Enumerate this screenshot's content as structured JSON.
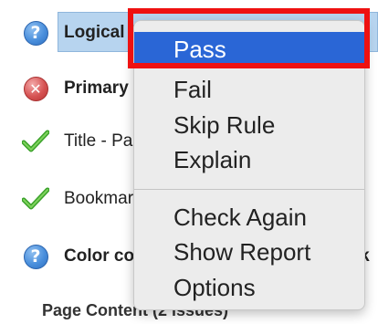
{
  "rows": [
    {
      "label": "Logical Reading Order Header",
      "icon": "question-icon"
    },
    {
      "label": "Primary language",
      "icon": "fail-icon"
    },
    {
      "label": "Title - Passed",
      "icon": "check-icon"
    },
    {
      "label": "Bookmarks - Passed",
      "icon": "check-icon"
    },
    {
      "label": "Color contrast - Needs manual check",
      "icon": "question-icon"
    }
  ],
  "section_heading": "Page Content (2 issues)",
  "context_menu": {
    "items": [
      "Pass",
      "Fail",
      "Skip Rule",
      "Explain",
      "Check Again",
      "Show Report",
      "Options"
    ],
    "selected": "Pass"
  },
  "colors": {
    "highlight": "#b7d4ef",
    "menu_selected": "#2a66d6",
    "annotation_box": "#ee1111"
  }
}
